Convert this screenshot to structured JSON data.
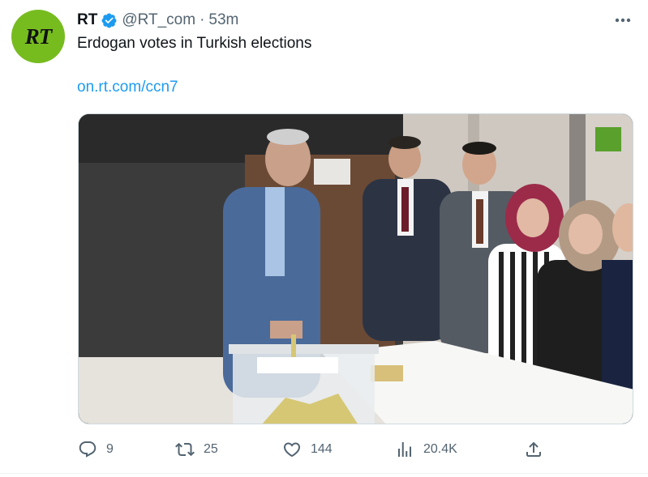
{
  "tweet": {
    "author": {
      "name": "RT",
      "handle": "@RT_com",
      "separator": "·",
      "time": "53m",
      "avatar_text": "RT",
      "avatar_color": "#77bc1f",
      "verified_icon": "verified-badge-icon"
    },
    "text": "Erdogan votes in Turkish elections",
    "link": "on.rt.com/ccn7",
    "media": {
      "watermark": "RT"
    },
    "actions": {
      "reply": {
        "icon": "reply-icon",
        "count": "9"
      },
      "retweet": {
        "icon": "retweet-icon",
        "count": "25"
      },
      "like": {
        "icon": "heart-icon",
        "count": "144"
      },
      "views": {
        "icon": "views-icon",
        "count": "20.4K"
      },
      "share": {
        "icon": "share-icon"
      }
    },
    "more_icon": "more-dots-icon"
  },
  "colors": {
    "accent": "#1d9bf0",
    "muted": "#536471",
    "text": "#0f1419",
    "brand_green": "#77bc1f"
  }
}
